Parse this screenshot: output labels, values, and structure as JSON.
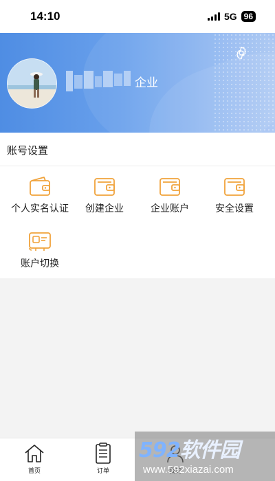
{
  "status_bar": {
    "time": "14:10",
    "network": "5G",
    "battery": "96"
  },
  "profile": {
    "name_suffix": "企业",
    "settings_icon": "gear-icon"
  },
  "account_settings": {
    "title": "账号设置",
    "items": [
      {
        "label": "个人实名认证",
        "icon": "wallet-icon"
      },
      {
        "label": "创建企业",
        "icon": "wallet-icon"
      },
      {
        "label": "企业账户",
        "icon": "wallet-icon"
      },
      {
        "label": "安全设置",
        "icon": "wallet-icon"
      },
      {
        "label": "账户切换",
        "icon": "id-card-icon"
      }
    ]
  },
  "bottom_nav": {
    "items": [
      {
        "label": "首页",
        "icon": "home-icon"
      },
      {
        "label": "订单",
        "icon": "order-icon"
      },
      {
        "label": "我的",
        "icon": "user-icon"
      }
    ]
  },
  "watermark": {
    "logo_number": "592",
    "logo_text": "软件园",
    "url": "www.592xiazai.com"
  },
  "colors": {
    "accent_orange": "#f0a23a",
    "banner_blue": "#4f8de3"
  }
}
